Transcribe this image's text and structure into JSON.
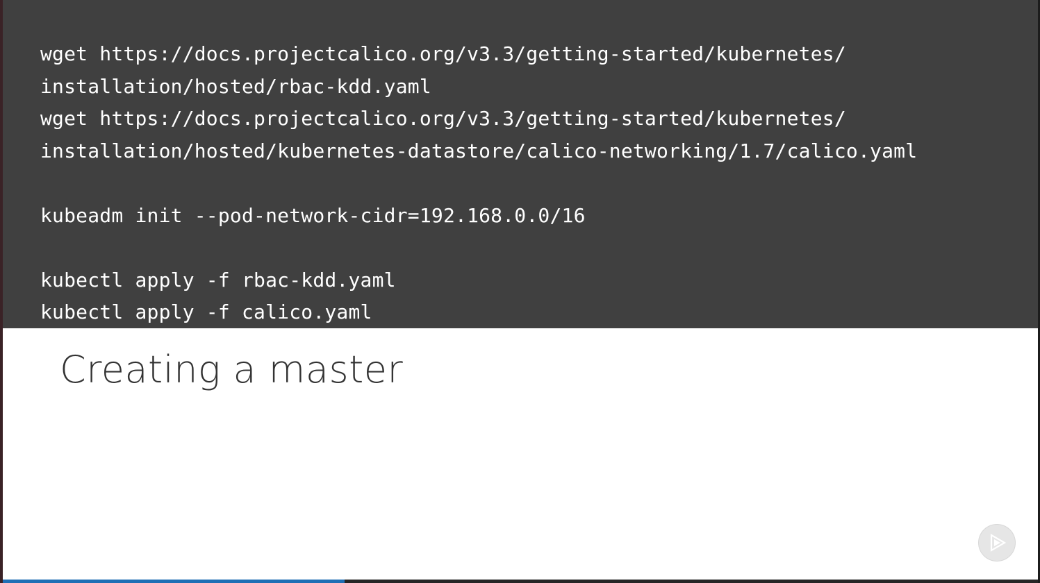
{
  "code": {
    "lines": [
      "wget https://docs.projectcalico.org/v3.3/getting-started/kubernetes/",
      "installation/hosted/rbac-kdd.yaml",
      "wget https://docs.projectcalico.org/v3.3/getting-started/kubernetes/",
      "installation/hosted/kubernetes-datastore/calico-networking/1.7/calico.yaml",
      "kubeadm init --pod-network-cidr=192.168.0.0/16",
      "kubectl apply -f rbac-kdd.yaml",
      "kubectl apply -f calico.yaml"
    ]
  },
  "slide": {
    "title": "Creating a master"
  },
  "player": {
    "progress_fraction": 0.33,
    "logo_icon": "pluralsight-play-icon"
  },
  "colors": {
    "code_background": "#404040",
    "code_text": "#ffffff",
    "title_text": "#333333",
    "progress": "#1f6fb5"
  }
}
